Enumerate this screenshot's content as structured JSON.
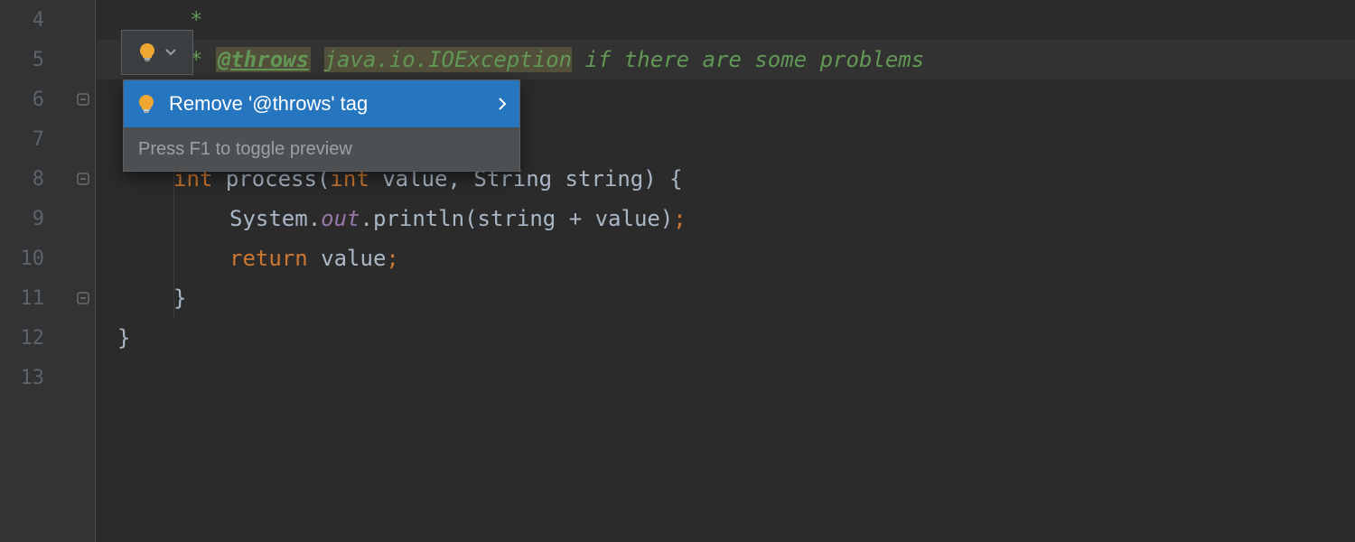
{
  "gutter": {
    "lines": [
      "4",
      "5",
      "6",
      "7",
      "8",
      "9",
      "10",
      "11",
      "12",
      "13"
    ]
  },
  "bulb": {
    "tooltip": "Show Intention Actions"
  },
  "popup": {
    "item": "Remove '@throws' tag",
    "hint": "Press F1 to toggle preview"
  },
  "line4": {
    "star": "*"
  },
  "line5": {
    "star": "* ",
    "throws": "@throws",
    "sp": " ",
    "exc": "java.io.IOException",
    "tail": " if there are some problems"
  },
  "line8": {
    "kw_int1": "int",
    "sp1": " ",
    "method": "process",
    "lp": "(",
    "kw_int2": "int",
    "sp2": " ",
    "p1": "value",
    "comma": ", ",
    "type": "String",
    "sp3": " ",
    "p2": "string",
    "rp": ") ",
    "brace": "{"
  },
  "line9": {
    "sys": "System.",
    "out": "out",
    "tail1": ".println(string + value)",
    "semi": ";"
  },
  "line10": {
    "ret": "return",
    "sp": " ",
    "val": "value",
    "semi": ";"
  },
  "line11": {
    "brace": "}"
  },
  "line12": {
    "brace": "}"
  }
}
